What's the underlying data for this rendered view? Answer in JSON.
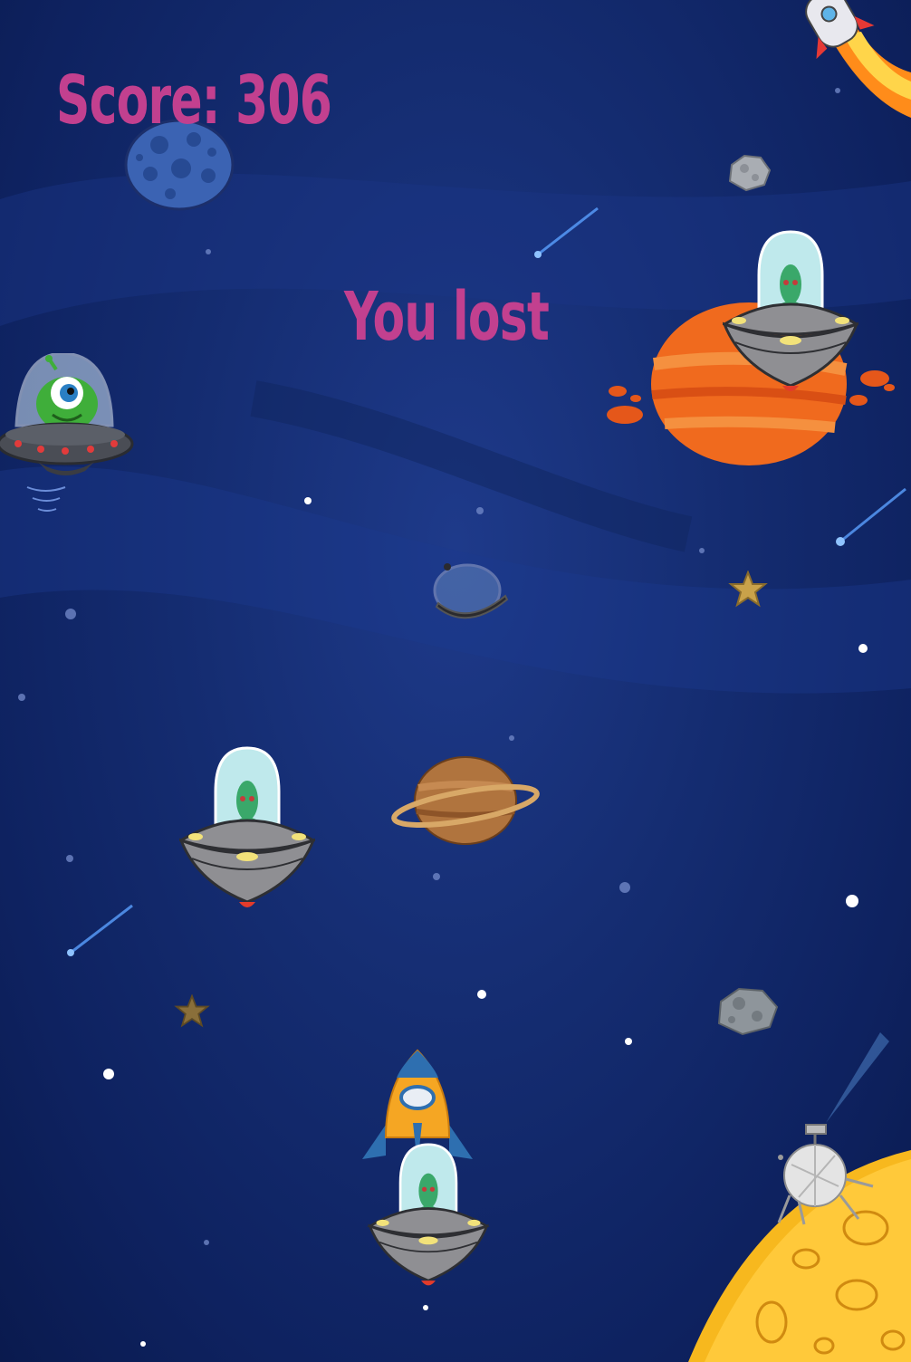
{
  "hud": {
    "score_text": "Score: 306",
    "status_text": "You lost"
  },
  "colors": {
    "hud_text": "#c2408f",
    "space_background": "#152d72"
  },
  "sprites": [
    "top-rocket",
    "blue-cratered-planet",
    "small-asteroid",
    "green-alien-ufo",
    "enemy-ufo-right",
    "orange-planet",
    "astronaut-helmet",
    "star-1",
    "ringed-planet",
    "enemy-ufo-left",
    "star-2",
    "grey-asteroid",
    "player-rocket",
    "enemy-ufo-bottom",
    "lunar-lander",
    "yellow-moon"
  ]
}
